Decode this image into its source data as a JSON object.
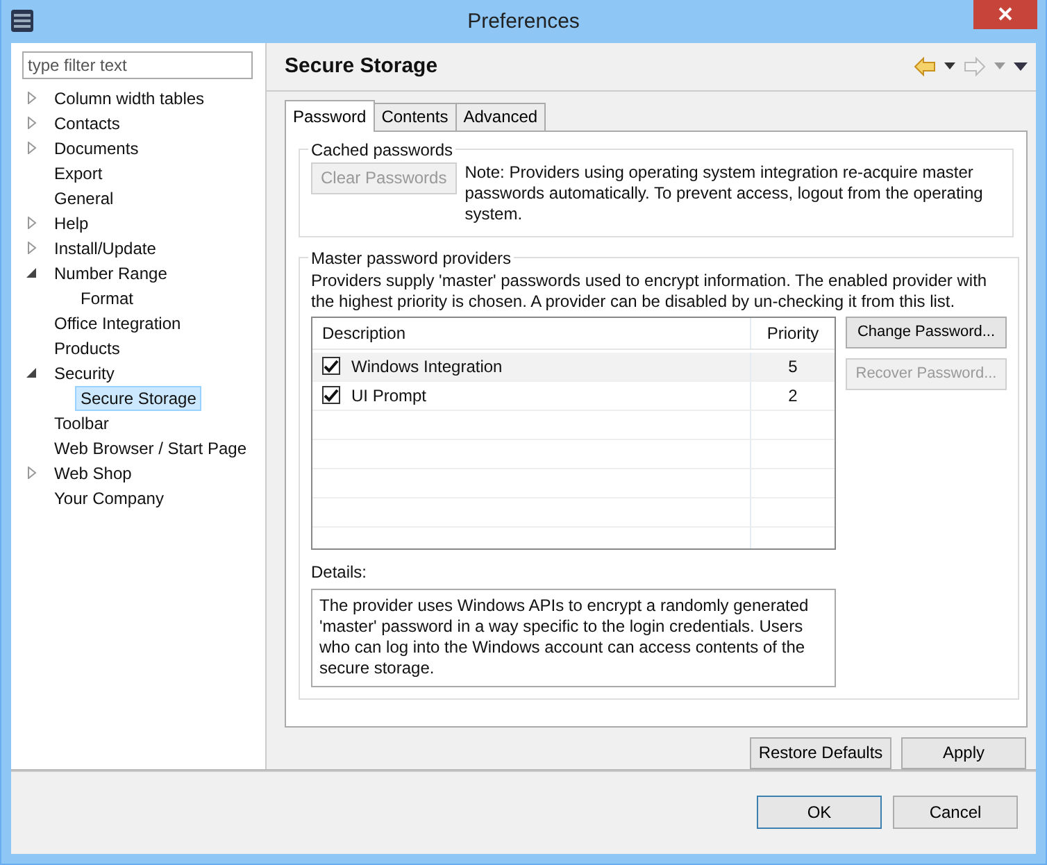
{
  "window": {
    "title": "Preferences"
  },
  "filter": {
    "placeholder": "type filter text"
  },
  "tree": [
    {
      "label": "Column width tables",
      "expanded": false,
      "selected": false
    },
    {
      "label": "Contacts",
      "expanded": false,
      "selected": false
    },
    {
      "label": "Documents",
      "expanded": false,
      "selected": false
    },
    {
      "label": "Export",
      "selected": false
    },
    {
      "label": "General",
      "selected": false
    },
    {
      "label": "Help",
      "expanded": false,
      "selected": false
    },
    {
      "label": "Install/Update",
      "expanded": false,
      "selected": false
    },
    {
      "label": "Number Range",
      "expanded": true,
      "selected": false,
      "children": [
        {
          "label": "Format",
          "selected": false
        }
      ]
    },
    {
      "label": "Office Integration",
      "selected": false
    },
    {
      "label": "Products",
      "selected": false
    },
    {
      "label": "Security",
      "expanded": true,
      "selected": false,
      "children": [
        {
          "label": "Secure Storage",
          "selected": true
        }
      ]
    },
    {
      "label": "Toolbar",
      "selected": false
    },
    {
      "label": "Web Browser / Start Page",
      "selected": false
    },
    {
      "label": "Web Shop",
      "expanded": false,
      "selected": false
    },
    {
      "label": "Your Company",
      "selected": false
    }
  ],
  "page": {
    "title": "Secure Storage"
  },
  "tabs": [
    {
      "label": "Password",
      "selected": true
    },
    {
      "label": "Contents",
      "selected": false
    },
    {
      "label": "Advanced",
      "selected": false
    }
  ],
  "cached": {
    "title": "Cached passwords",
    "button": {
      "label": "Clear Passwords",
      "disabled": true
    },
    "note": "Note: Providers using operating system integration re-acquire master passwords automatically. To prevent access, logout from the operating system."
  },
  "providers": {
    "title": "Master password providers",
    "description": "Providers supply 'master' passwords used to encrypt information. The enabled provider with the highest priority is chosen. A provider can be disabled by un-checking it from this list.",
    "columns": [
      "Description",
      "Priority"
    ],
    "rows": [
      {
        "name": "Windows Integration",
        "priority": "5",
        "checked": true,
        "selected": true
      },
      {
        "name": "UI Prompt",
        "priority": "2",
        "checked": true,
        "selected": false
      }
    ],
    "buttons": [
      {
        "label": "Change Password...",
        "disabled": false
      },
      {
        "label": "Recover Password...",
        "disabled": true
      }
    ],
    "details_label": "Details:",
    "details": "The provider uses Windows APIs to encrypt a randomly generated 'master' password in a way specific to the login credentials. Users who can log into the Windows account can access contents of the secure storage."
  },
  "page_buttons": [
    "Restore Defaults",
    "Apply"
  ],
  "dialog_buttons": [
    {
      "label": "OK",
      "default": true
    },
    {
      "label": "Cancel",
      "default": false
    }
  ]
}
